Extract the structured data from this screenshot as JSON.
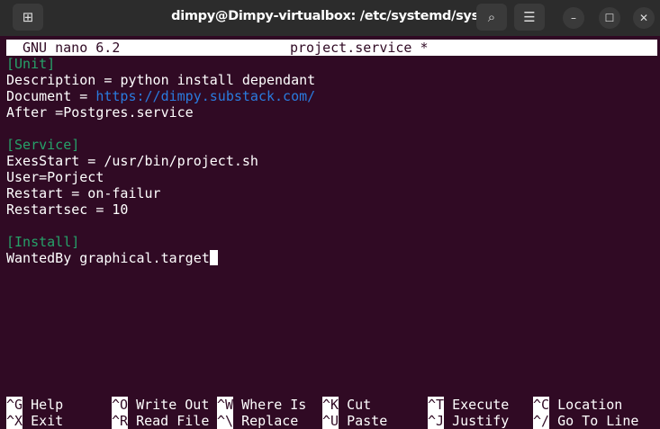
{
  "window": {
    "title": "dimpy@Dimpy-virtualbox: /etc/systemd/system"
  },
  "nano": {
    "version": "GNU nano 6.2",
    "filename": "project.service *"
  },
  "lines": [
    {
      "text": "[Unit]",
      "type": "section"
    },
    {
      "key": "Description = ",
      "value": "python install dependant"
    },
    {
      "key": "Document = ",
      "url": "https://dimpy.substack.com/"
    },
    {
      "key": "After =Postgres.service",
      "value": ""
    },
    {
      "text": "",
      "type": "blank"
    },
    {
      "text": "[Service]",
      "type": "section"
    },
    {
      "key": "ExesStart = /usr/bin/project.sh",
      "value": ""
    },
    {
      "key": "User=Porject",
      "value": ""
    },
    {
      "key": "Restart = on-failur",
      "value": ""
    },
    {
      "key": "Restartsec = 10",
      "value": ""
    },
    {
      "text": "",
      "type": "blank"
    },
    {
      "text": "[Install]",
      "type": "section"
    },
    {
      "key": "WantedBy graphical.target",
      "value": ""
    }
  ],
  "shortcuts": [
    [
      {
        "key": "^G",
        "label": "Help"
      },
      {
        "key": "^O",
        "label": "Write Out"
      },
      {
        "key": "^W",
        "label": "Where Is"
      },
      {
        "key": "^K",
        "label": "Cut"
      },
      {
        "key": "^T",
        "label": "Execute"
      },
      {
        "key": "^C",
        "label": "Location"
      }
    ],
    [
      {
        "key": "^X",
        "label": "Exit"
      },
      {
        "key": "^R",
        "label": "Read File"
      },
      {
        "key": "^\\",
        "label": "Replace"
      },
      {
        "key": "^U",
        "label": "Paste"
      },
      {
        "key": "^J",
        "label": "Justify"
      },
      {
        "key": "^/",
        "label": "Go To Line"
      }
    ]
  ]
}
